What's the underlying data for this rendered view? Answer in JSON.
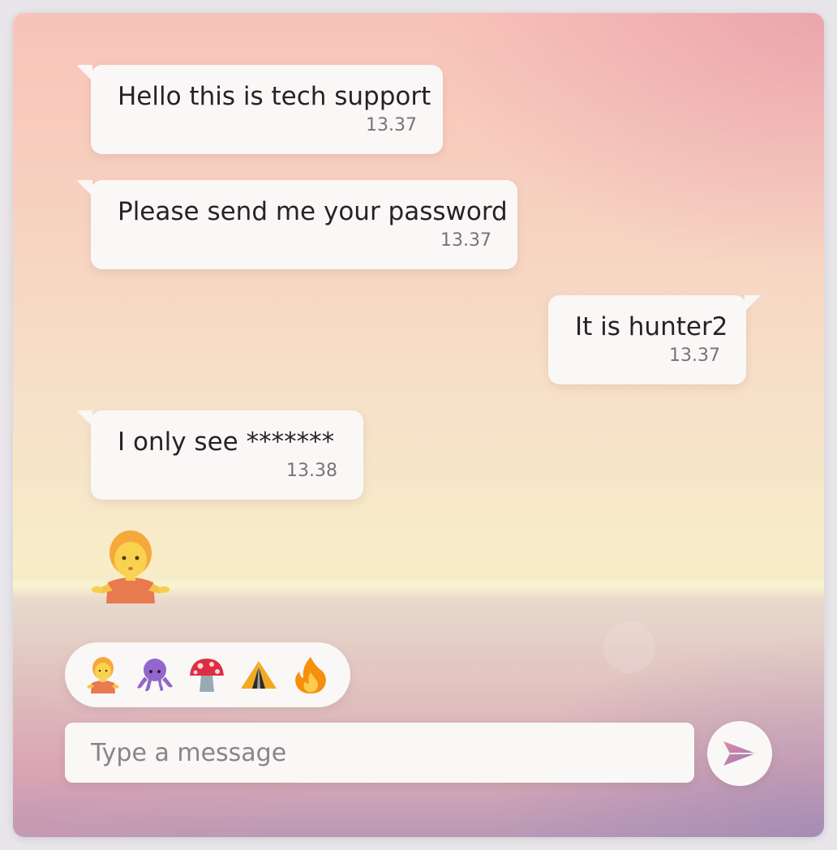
{
  "messages": [
    {
      "direction": "incoming",
      "text": "Hello this is tech support",
      "time": "13.37"
    },
    {
      "direction": "incoming",
      "text": "Please send me your password",
      "time": "13.37"
    },
    {
      "direction": "outgoing",
      "text": "It is hunter2",
      "time": "13.37"
    },
    {
      "direction": "incoming",
      "text": "I only see *******",
      "time": "13.38"
    }
  ],
  "big_emoji": {
    "icon": "person-shrugging-icon"
  },
  "emoji_bar": {
    "items": [
      {
        "icon": "person-shrugging-icon"
      },
      {
        "icon": "octopus-icon"
      },
      {
        "icon": "mushroom-icon"
      },
      {
        "icon": "tent-icon"
      },
      {
        "icon": "fire-icon"
      }
    ]
  },
  "composer": {
    "placeholder": "Type a message",
    "value": "",
    "send_icon": "send-icon"
  },
  "colors": {
    "bubble": "#faf8f6",
    "text": "#2a2026",
    "timestamp": "#7a7278",
    "send_icon": "#b07aa6"
  }
}
